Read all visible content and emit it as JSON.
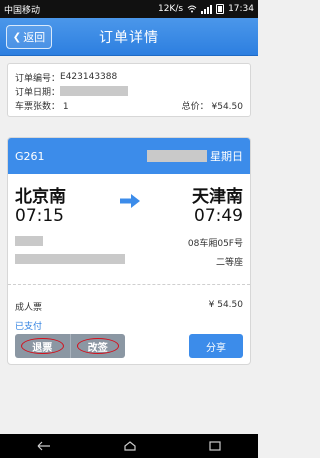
{
  "status_bar": {
    "carrier": "中国移动",
    "speed": "12K/s",
    "time": "17:34"
  },
  "header": {
    "back_label": "返回",
    "title": "订单详情"
  },
  "order": {
    "number_label": "订单编号：",
    "number_value": "E423143388",
    "date_label": "订单日期：",
    "count_label": "车票张数：",
    "count_value": "1",
    "total_label": "总价：",
    "total_value": "¥54.50"
  },
  "ticket": {
    "train_no": "G261",
    "weekday": "星期日",
    "from_station": "北京南",
    "to_station": "天津南",
    "depart_time": "07:15",
    "arrive_time": "07:49",
    "seat": "08车厢05F号",
    "seat_class": "二等座",
    "passenger_type": "成人票",
    "price": "¥ 54.50",
    "pay_status": "已支付"
  },
  "actions": {
    "refund_label": "退票",
    "change_label": "改签",
    "share_label": "分享"
  },
  "colors": {
    "accent": "#3c8cea",
    "annotation": "#d3101c"
  }
}
